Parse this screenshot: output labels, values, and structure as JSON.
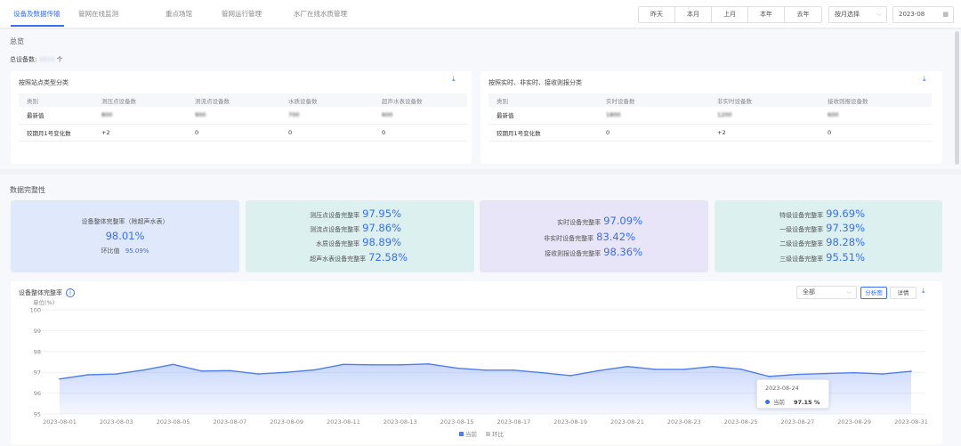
{
  "nav": {
    "tabs": [
      "设备及数据传输",
      "管网在线监测",
      "重点场馆",
      "管网运行管理",
      "水厂在线水质管理"
    ],
    "active_tab": 0,
    "period_buttons": [
      "昨天",
      "本月",
      "上月",
      "本年",
      "去年"
    ],
    "period_select": "按月选择",
    "month_value": "2023-08"
  },
  "overview": {
    "title": "总览",
    "total_label": "总设备数:",
    "total_value": "3600",
    "total_unit": "个",
    "left_card": {
      "title": "按照站点类型分类",
      "columns": [
        "类别",
        "测压点设备数",
        "测流点设备数",
        "水质设备数",
        "超声水表设备数"
      ],
      "rows": [
        [
          "最新值",
          "800",
          "900",
          "700",
          "600"
        ],
        [
          "较期月1号变化数",
          "+2",
          "0",
          "0",
          "0"
        ]
      ]
    },
    "right_card": {
      "title": "按照实时、非实时、接收则报分类",
      "columns": [
        "类别",
        "实时设备数",
        "非实时设备数",
        "接收则报设备数"
      ],
      "rows": [
        [
          "最新值",
          "1800",
          "1200",
          "600"
        ],
        [
          "较期月1号变化数",
          "0",
          "+2",
          "0"
        ]
      ]
    }
  },
  "integrity": {
    "title": "数据完整性",
    "card1": {
      "label": "设备整体完整率（除超声水表）",
      "value": "98.01%",
      "ratio_label": "环比值",
      "ratio_value": "95.09%"
    },
    "card2": [
      {
        "label": "测压点设备完整率",
        "value": "97.95%"
      },
      {
        "label": "测流点设备完整率",
        "value": "97.86%"
      },
      {
        "label": "水质设备完整率",
        "value": "98.89%"
      },
      {
        "label": "超声水表设备完整率",
        "value": "72.58%"
      }
    ],
    "card3": [
      {
        "label": "实时设备完整率",
        "value": "97.09%"
      },
      {
        "label": "非实时设备完整率",
        "value": "83.42%"
      },
      {
        "label": "接收则报设备完整率",
        "value": "98.36%"
      }
    ],
    "card4": [
      {
        "label": "特级设备完整率",
        "value": "99.69%"
      },
      {
        "label": "一级设备完整率",
        "value": "97.39%"
      },
      {
        "label": "二级设备完整率",
        "value": "98.28%"
      },
      {
        "label": "三级设备完整率",
        "value": "95.51%"
      }
    ]
  },
  "chart_panel": {
    "title": "设备整体完整率",
    "filter_select": "全部",
    "btn_analysis": "分析图",
    "btn_detail": "详情"
  },
  "chart_data": {
    "type": "area",
    "ylabel": "单位(%)",
    "ylim": [
      95,
      100
    ],
    "yticks": [
      "100",
      "99",
      "98",
      "97",
      "96",
      "95"
    ],
    "x": [
      "2023-08-01",
      "2023-08-02",
      "2023-08-03",
      "2023-08-04",
      "2023-08-05",
      "2023-08-06",
      "2023-08-07",
      "2023-08-08",
      "2023-08-09",
      "2023-08-10",
      "2023-08-11",
      "2023-08-12",
      "2023-08-13",
      "2023-08-14",
      "2023-08-15",
      "2023-08-16",
      "2023-08-17",
      "2023-08-18",
      "2023-08-19",
      "2023-08-20",
      "2023-08-21",
      "2023-08-22",
      "2023-08-23",
      "2023-08-24",
      "2023-08-25",
      "2023-08-26",
      "2023-08-27",
      "2023-08-28",
      "2023-08-29",
      "2023-08-30",
      "2023-08-31"
    ],
    "xticks": [
      "2023-08-01",
      "2023-08-03",
      "2023-08-05",
      "2023-08-07",
      "2023-08-09",
      "2023-08-11",
      "2023-08-13",
      "2023-08-15",
      "2023-08-17",
      "2023-08-19",
      "2023-08-21",
      "2023-08-23",
      "2023-08-25",
      "2023-08-27",
      "2023-08-29",
      "2023-08-31"
    ],
    "series": [
      {
        "name": "当前",
        "values": [
          96.68,
          96.88,
          96.92,
          97.12,
          97.38,
          97.06,
          97.08,
          96.92,
          97.0,
          97.12,
          97.38,
          97.36,
          97.36,
          97.4,
          97.2,
          97.1,
          97.1,
          96.98,
          96.84,
          97.08,
          97.28,
          97.14,
          97.14,
          97.28,
          97.15,
          96.8,
          96.9,
          96.94,
          96.98,
          96.92,
          97.05
        ],
        "color": "#4f7df3"
      },
      {
        "name": "环比",
        "values": [],
        "color": "#c7c9cf"
      }
    ],
    "tooltip": {
      "date": "2023-08-24",
      "series": "当前",
      "value": "97.15 %"
    },
    "grid": true,
    "legend": "bottom"
  }
}
